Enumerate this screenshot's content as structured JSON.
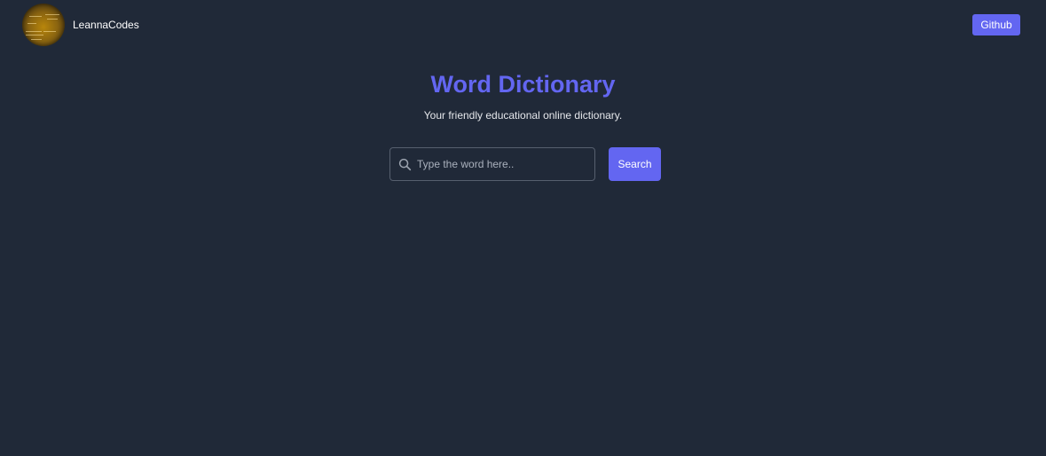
{
  "navbar": {
    "brand_name": "LeannaCodes",
    "avatar_icon": "gold-circle-logo",
    "github_label": "Github"
  },
  "hero": {
    "title": "Word Dictionary",
    "subtitle": "Your friendly educational online dictionary."
  },
  "search": {
    "icon": "search-icon",
    "placeholder": "Type the word here..",
    "value": "",
    "button_label": "Search"
  },
  "colors": {
    "background": "#202938",
    "accent": "#6366f1",
    "text": "#ffffff"
  }
}
